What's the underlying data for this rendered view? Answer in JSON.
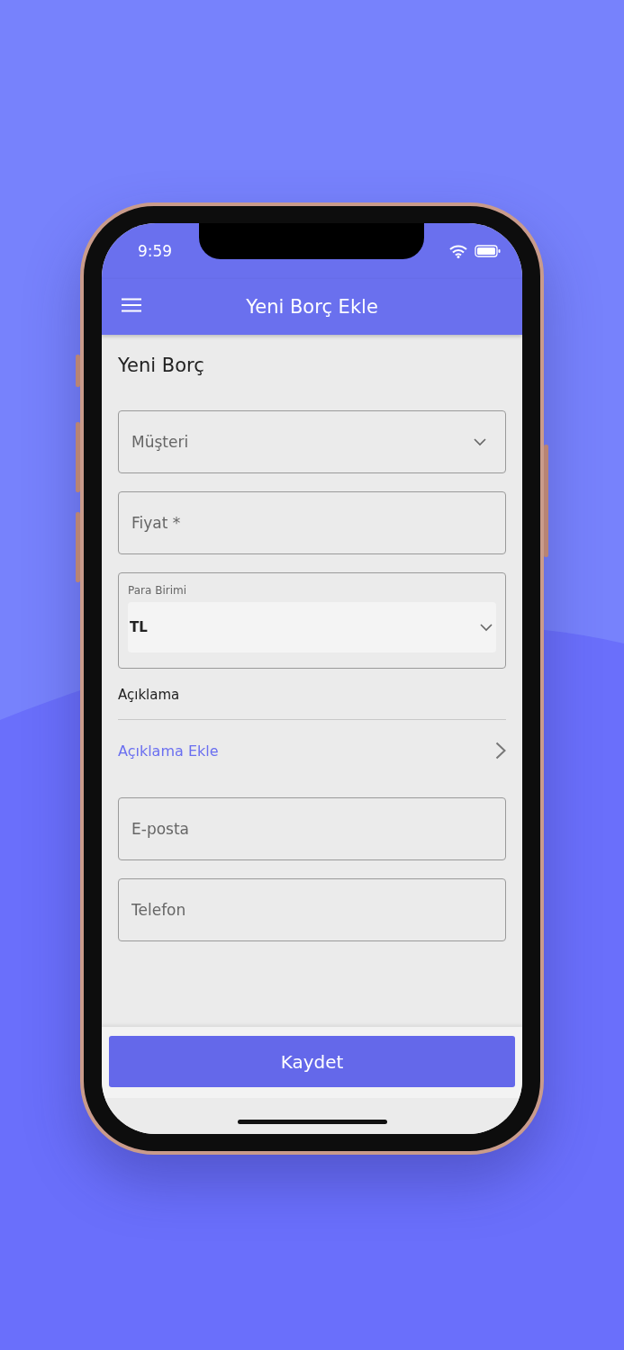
{
  "status_bar": {
    "time": "9:59"
  },
  "app_bar": {
    "title": "Yeni Borç Ekle"
  },
  "heading": "Yeni Borç",
  "fields": [
    {
      "kind": "dropdown",
      "placeholder": "Müşteri"
    },
    {
      "kind": "input",
      "placeholder": "Fiyat *"
    },
    {
      "kind": "labeled_dropdown",
      "label": "Para Birimi",
      "value": "TL"
    }
  ],
  "description": {
    "label": "Açıklama",
    "link": "Açıklama Ekle"
  },
  "contact_fields": [
    {
      "kind": "input",
      "placeholder": "E-posta"
    },
    {
      "kind": "input",
      "placeholder": "Telefon"
    }
  ],
  "save_button": "Kaydet"
}
